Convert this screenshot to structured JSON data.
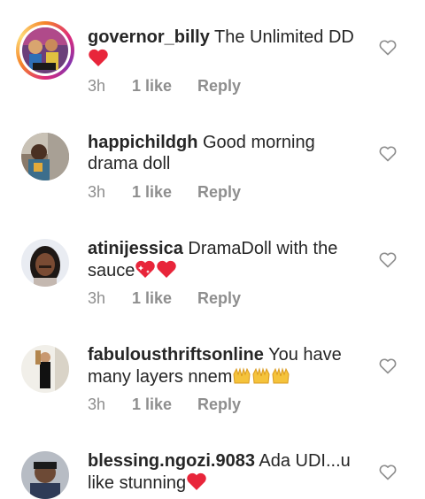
{
  "comments": [
    {
      "username": "governor_billy",
      "text": "The Unlimited DD",
      "emoji": "❤️",
      "time": "3h",
      "likes": "1 like",
      "reply": "Reply",
      "avatar_style": "story-ring"
    },
    {
      "username": "happichildgh",
      "text": "Good morning drama doll",
      "emoji": "",
      "time": "3h",
      "likes": "1 like",
      "reply": "Reply"
    },
    {
      "username": "atinijessica",
      "text": "DramaDoll with the sauce",
      "emoji": "💖❤️",
      "time": "3h",
      "likes": "1 like",
      "reply": "Reply"
    },
    {
      "username": "fabulousthriftsonline",
      "text": "You have many layers nnem",
      "emoji": "🙌🙌🙌",
      "time": "3h",
      "likes": "1 like",
      "reply": "Reply"
    },
    {
      "username": "blessing.ngozi.9083",
      "text": "Ada UDI...u like stunning",
      "emoji": "❤️",
      "time": "",
      "likes": "",
      "reply": ""
    }
  ],
  "icons": {
    "like": "heart-outline-icon",
    "emoji_heart": "red-heart-icon",
    "emoji_sparkle_heart": "sparkling-heart-icon",
    "emoji_hands": "raising-hands-icon"
  },
  "colors": {
    "text": "#262626",
    "meta": "#8e8e8e",
    "heart": "#e8253a",
    "story_ring": "#dd2a7b"
  }
}
